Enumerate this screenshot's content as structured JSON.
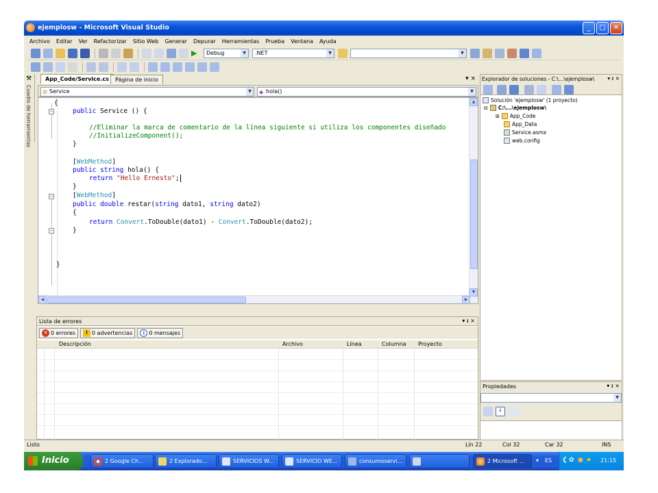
{
  "window": {
    "title": "ejemplosw - Microsoft Visual Studio"
  },
  "menu": [
    "Archivo",
    "Editar",
    "Ver",
    "Refactorizar",
    "Sitio Web",
    "Generar",
    "Depurar",
    "Herramientas",
    "Prueba",
    "Ventana",
    "Ayuda"
  ],
  "toolbar": {
    "config": "Debug",
    "platform": ".NET"
  },
  "side_strip": "Cuadro de herramientas",
  "tabs": [
    {
      "label": "App_Code/Service.cs"
    },
    {
      "label": "Página de inicio"
    }
  ],
  "tab_controls": "▾ ×",
  "nav": {
    "class": "Service",
    "member": "hola()"
  },
  "code": {
    "l1": "{",
    "l2a": "public",
    "l2b": " Service () {",
    "l3": "//Eliminar la marca de comentario de la línea siguiente si utiliza los componentes diseñado",
    "l4": "//InitializeComponent();",
    "l5": "}",
    "l6a": "[",
    "l6b": "WebMethod",
    "l6c": "]",
    "l7a": "public string",
    "l7b": " hola() {",
    "l8a": "return ",
    "l8b": "\"Hello Ernesto\"",
    "l8c": ";",
    "l9": "}",
    "l10a": "[",
    "l10b": "WebMethod",
    "l10c": "]",
    "l11a": "public double",
    "l11b": " restar(",
    "l11c": "string",
    "l11d": " dato1, ",
    "l11e": "string",
    "l11f": " dato2)",
    "l12": "{",
    "l13a": "return ",
    "l13b": "Convert",
    "l13c": ".ToDouble(dato1) - ",
    "l13d": "Convert",
    "l13e": ".ToDouble(dato2);",
    "l14": "}",
    "l15": "}"
  },
  "errors": {
    "title": "Lista de errores",
    "controls": "▾ ᵻ ×",
    "btn_errors": "0 errores",
    "btn_warnings": "0 advertencias",
    "btn_messages": "0 mensajes",
    "cols": [
      "Descripción",
      "Archivo",
      "Línea",
      "Columna",
      "Proyecto"
    ]
  },
  "solution": {
    "title": "Explorador de soluciones - C:\\...\\ejemplosw\\",
    "controls": "▾ ᵻ ×",
    "root": "Solución 'ejemplosw' (1 proyecto)",
    "project": "C:\\...\\ejemplosw\\",
    "items": [
      "App_Code",
      "App_Data",
      "Service.asmx",
      "web.config"
    ]
  },
  "properties": {
    "title": "Propiedades",
    "controls": "▾ ᵻ ×"
  },
  "status": {
    "left": "Listo",
    "line": "Lín 22",
    "col": "Col 32",
    "car": "Car 32",
    "mode": "INS"
  },
  "taskbar": {
    "start": "Inicio",
    "tasks": [
      "2 Google Ch...",
      "2 Explorado...",
      "SERVICIOS W...",
      "SERVICIO WE...",
      "consumoservi...",
      "",
      "2 Microsoft ..."
    ],
    "lang": "ES",
    "clock": "21:15"
  },
  "colors": {
    "keyword": "#0000ff",
    "comment": "#008000",
    "string": "#a31515",
    "type": "#2b91af",
    "titlebar": "#0a55d8",
    "start": "#2f8a2f"
  }
}
